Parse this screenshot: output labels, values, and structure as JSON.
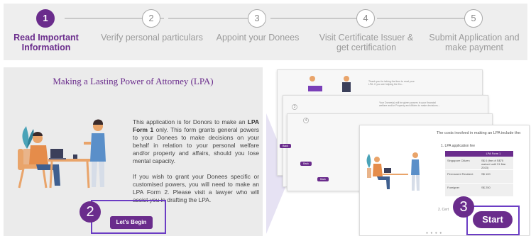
{
  "stepper": {
    "steps": [
      {
        "number": "1",
        "label": "Read Important Information",
        "active": true
      },
      {
        "number": "2",
        "label": "Verify personal particulars",
        "active": false
      },
      {
        "number": "3",
        "label": "Appoint your Donees",
        "active": false
      },
      {
        "number": "4",
        "label": "Visit Certificate Issuer & get certification",
        "active": false
      },
      {
        "number": "5",
        "label": "Submit Application and make payment",
        "active": false
      }
    ]
  },
  "left_panel": {
    "title": "Making a Lasting Power of Attorney (LPA)",
    "para1_pre": "This application is for Donors to make an ",
    "para1_bold": "LPA Form 1",
    "para1_post": " only.  This form grants general powers to your Donees to make decisions on your behalf in relation to your personal welfare and/or property and affairs, should you lose mental capacity.",
    "para2": "If you wish to grant your Donees specific or customised powers, you will need to make an LPA Form 2. Please visit a lawyer who will assist you in drafting the LPA.",
    "button_label": "Let's Begin",
    "badge": "2"
  },
  "right_panel": {
    "back_label": "Back",
    "costs_title": "The costs involved in making an LPA include the:",
    "fee_heading": "1. LPA application fee",
    "fee_table_header": "LPA Form 1",
    "fee_rows": [
      {
        "label": "Singapore Citizen",
        "value": "S$ 0 (fee of S$75 waived until 31 Mar 2023)"
      },
      {
        "label": "Permanent Resident",
        "value": "S$ 100"
      },
      {
        "label": "Foreigner",
        "value": "S$ 250"
      }
    ],
    "step2_fragment": "2. Cert",
    "card_text_1": "Thank you for taking the time to read your LPA. If you are helping the Do...",
    "card_text_2": "Your Donee(s) will be given powers in your financial welfare and/or Property and Affairs to make decisions...",
    "start_label": "Start",
    "badge": "3"
  },
  "colors": {
    "accent": "#6a2c8c",
    "highlight": "#6b3cc4"
  }
}
